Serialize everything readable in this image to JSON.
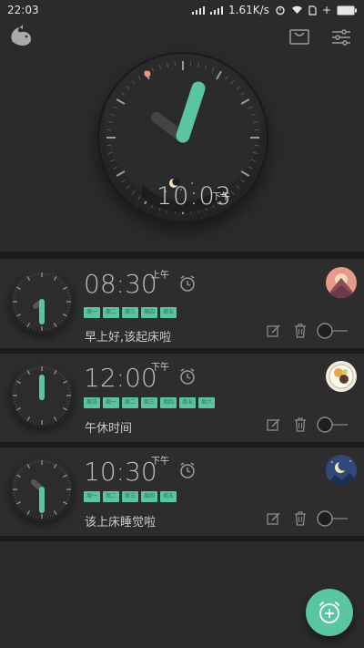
{
  "status": {
    "time": "22:03",
    "speed": "1.61K/s",
    "plus": "+"
  },
  "topbar": {
    "logo_icon": "bird-logo-icon",
    "store_icon": "bag-icon",
    "settings_icon": "sliders-icon"
  },
  "main_clock": {
    "digital_time": "10:03",
    "ampm": "下午"
  },
  "alarms": [
    {
      "time": "08:30",
      "ampm": "上午",
      "label": "早上好,该起床啦",
      "days": [
        "周一",
        "周二",
        "周三",
        "周四",
        "周五"
      ],
      "avatar": "mountain-sunset-avatar"
    },
    {
      "time": "12:00",
      "ampm": "下午",
      "label": "午休时间",
      "days": [
        "周日",
        "周一",
        "周二",
        "周三",
        "周四",
        "周五",
        "周六"
      ],
      "avatar": "food-plate-avatar"
    },
    {
      "time": "10:30",
      "ampm": "下午",
      "label": "该上床睡觉啦",
      "days": [
        "周一",
        "周二",
        "周三",
        "周四",
        "周五"
      ],
      "avatar": "night-moon-avatar"
    }
  ],
  "colors": {
    "accent": "#59c6a0",
    "background": "#2b2b2b",
    "card": "#2d2d2d",
    "divider": "#1b1b1b"
  },
  "fab_icon": "add-alarm-icon"
}
